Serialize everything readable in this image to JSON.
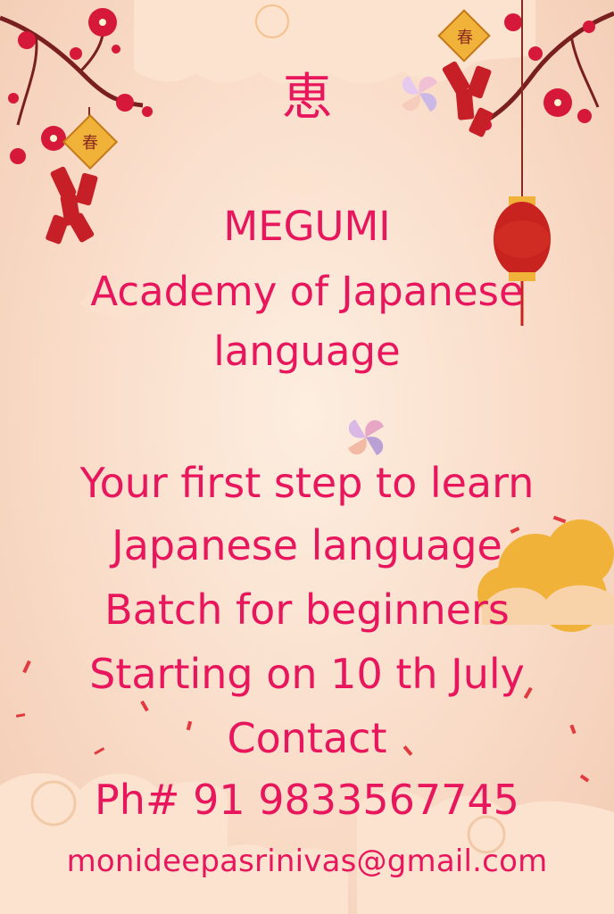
{
  "colors": {
    "text": "#e8175d",
    "background_light": "#fdeee0",
    "background_warm": "#f3cbb3",
    "cloud": "#fbe3cf",
    "cloud_gold": "#f6c08a",
    "blossom": "#d6183a",
    "branch": "#7a1f1f",
    "lantern": "#c8231f",
    "firecracker": "#c71f27",
    "gold": "#f1b23a"
  },
  "icons": {
    "top_left": "cherry-blossom-branch-icon",
    "top_right": "cherry-blossom-branch-icon",
    "left_firecracker": "firecracker-bundle-icon",
    "right_firecracker": "firecracker-bundle-icon",
    "lantern": "paper-lantern-icon",
    "clouds": "cloud-icon",
    "pinwheel": "pinwheel-icon"
  },
  "poster": {
    "kanji": "恵",
    "firecracker_glyph": "春",
    "lines": [
      "MEGUMI",
      "Academy of Japanese",
      "language",
      "Your first step to learn",
      "Japanese language",
      "Batch for beginners",
      "Starting on 10 th July",
      "Contact",
      "Ph# 91 9833567745",
      "monideepasrinivas@gmail.com"
    ]
  }
}
